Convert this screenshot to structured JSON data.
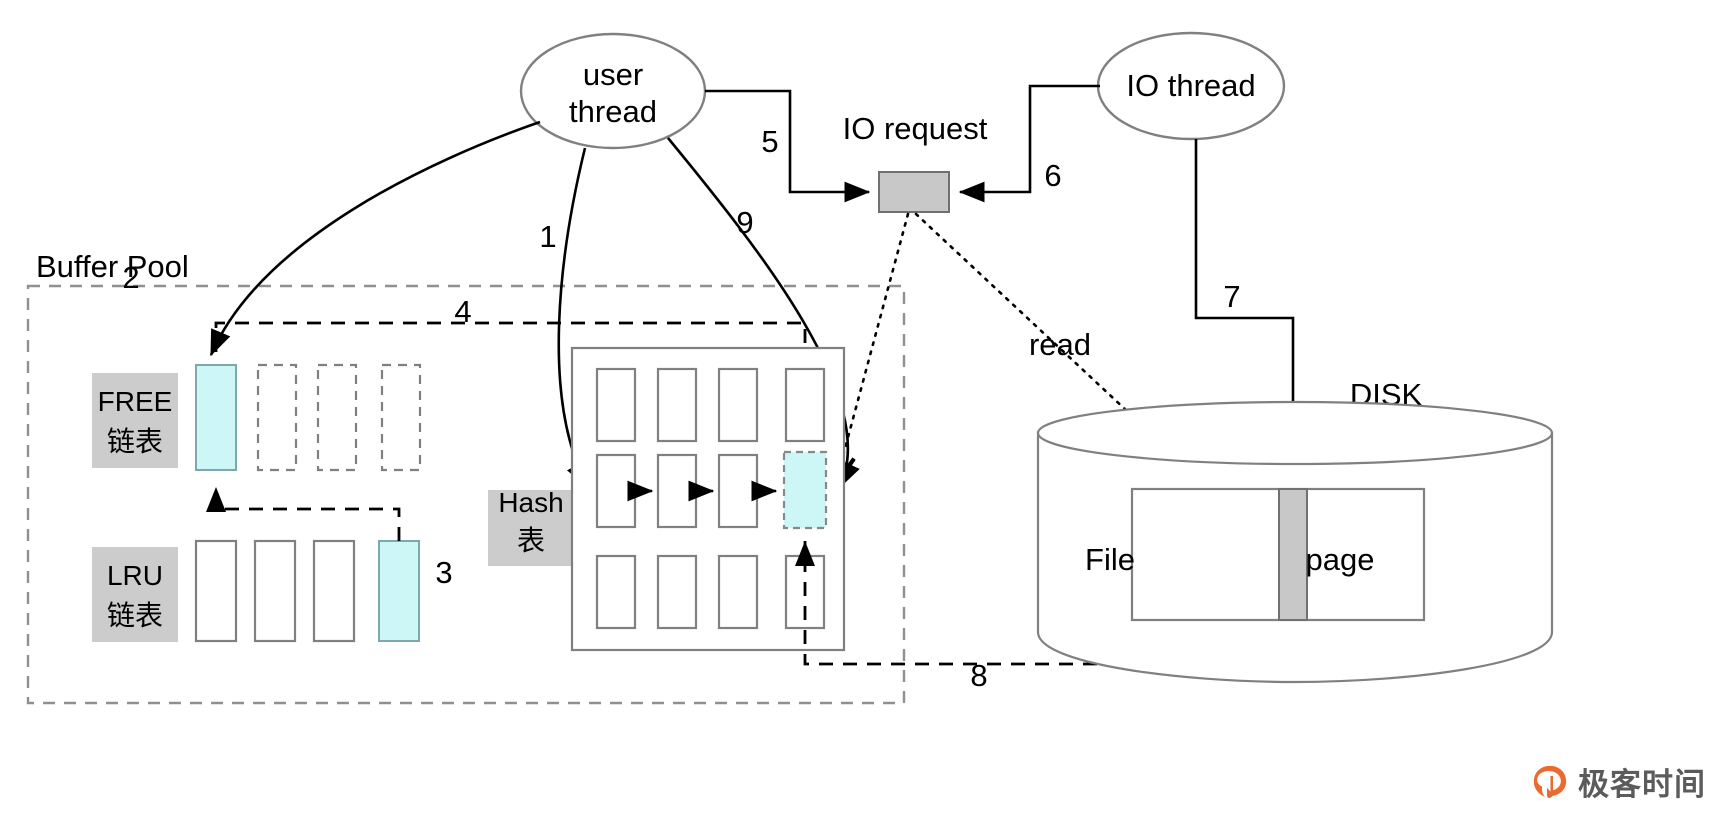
{
  "diagram": {
    "title_visible": false,
    "nodes": {
      "user_thread": "user\nthread",
      "user_thread_line1": "user",
      "user_thread_line2": "thread",
      "io_thread": "IO thread",
      "io_request": "IO request",
      "buffer_pool": "Buffer Pool",
      "free_list_line1": "FREE",
      "free_list_line2": "链表",
      "lru_list_line1": "LRU",
      "lru_list_line2": "链表",
      "hash_line1": "Hash",
      "hash_line2": "表",
      "disk": "DISK",
      "file": "File",
      "page": "page",
      "read": "read"
    },
    "step_labels": {
      "s1": "1",
      "s2": "2",
      "s3": "3",
      "s4": "4",
      "s5": "5",
      "s6": "6",
      "s7": "7",
      "s8": "8",
      "s9": "9"
    },
    "colors": {
      "highlight_cyan": "#cdf6f7",
      "gray_fill": "#c8c8c8",
      "label_bg": "#cccccc",
      "outline": "#808080",
      "line": "#000000",
      "watermark_orange": "#ea6a30",
      "watermark_text": "#5b5b5b"
    },
    "free_list": {
      "blocks": [
        {
          "state": "occupied"
        },
        {
          "state": "empty"
        },
        {
          "state": "empty"
        },
        {
          "state": "empty"
        }
      ]
    },
    "lru_list": {
      "blocks": [
        {
          "state": "plain"
        },
        {
          "state": "plain"
        },
        {
          "state": "plain"
        },
        {
          "state": "occupied"
        }
      ]
    },
    "hash_table": {
      "rows": 3,
      "cols": 4,
      "highlight_cell": {
        "row": 2,
        "col": 4
      }
    },
    "watermark": {
      "text": "极客时间"
    }
  }
}
